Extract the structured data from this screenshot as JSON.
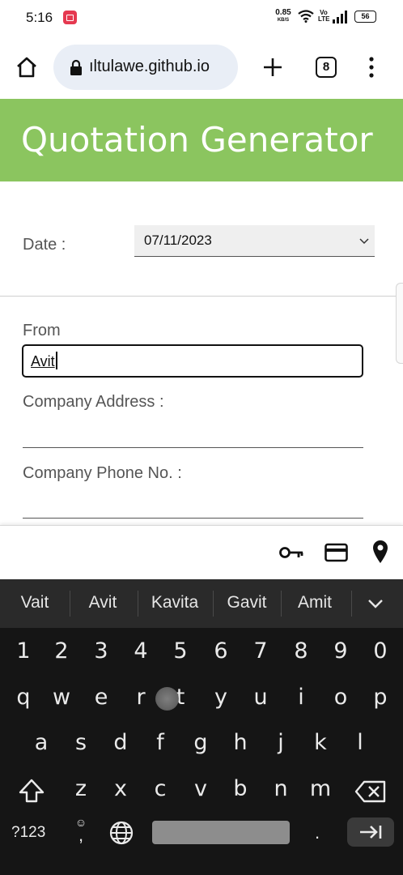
{
  "status_bar": {
    "time": "5:16",
    "net_speed": "0.85",
    "net_unit": "KB/S",
    "volte": "Vo LTE",
    "battery": "56"
  },
  "browser": {
    "url": "ıltulawe.github.io",
    "tab_count": "8"
  },
  "page": {
    "title": "Quotation Generator",
    "header_color": "#8bc55f",
    "date_label": "Date :",
    "date_value": "07/11/2023",
    "from_label": "From",
    "from_value": "Avit",
    "company_address_label": "Company Address :",
    "company_phone_label": "Company Phone No. :"
  },
  "autofill": {
    "icons": [
      "key-icon",
      "credit-card-icon",
      "location-pin-icon"
    ]
  },
  "keyboard": {
    "suggestions": [
      "Vait",
      "Avit",
      "Kavita",
      "Gavit",
      "Amit"
    ],
    "number_row": [
      "1",
      "2",
      "3",
      "4",
      "5",
      "6",
      "7",
      "8",
      "9",
      "0"
    ],
    "row_q": [
      "q",
      "w",
      "e",
      "r",
      "t",
      "y",
      "u",
      "i",
      "o",
      "p"
    ],
    "row_a": [
      "a",
      "s",
      "d",
      "f",
      "g",
      "h",
      "j",
      "k",
      "l"
    ],
    "row_z": [
      "z",
      "x",
      "c",
      "v",
      "b",
      "n",
      "m"
    ],
    "symbols_key": "?123",
    "emoji_key_top": "☺",
    "emoji_key_bottom": ",",
    "period_key": "."
  }
}
